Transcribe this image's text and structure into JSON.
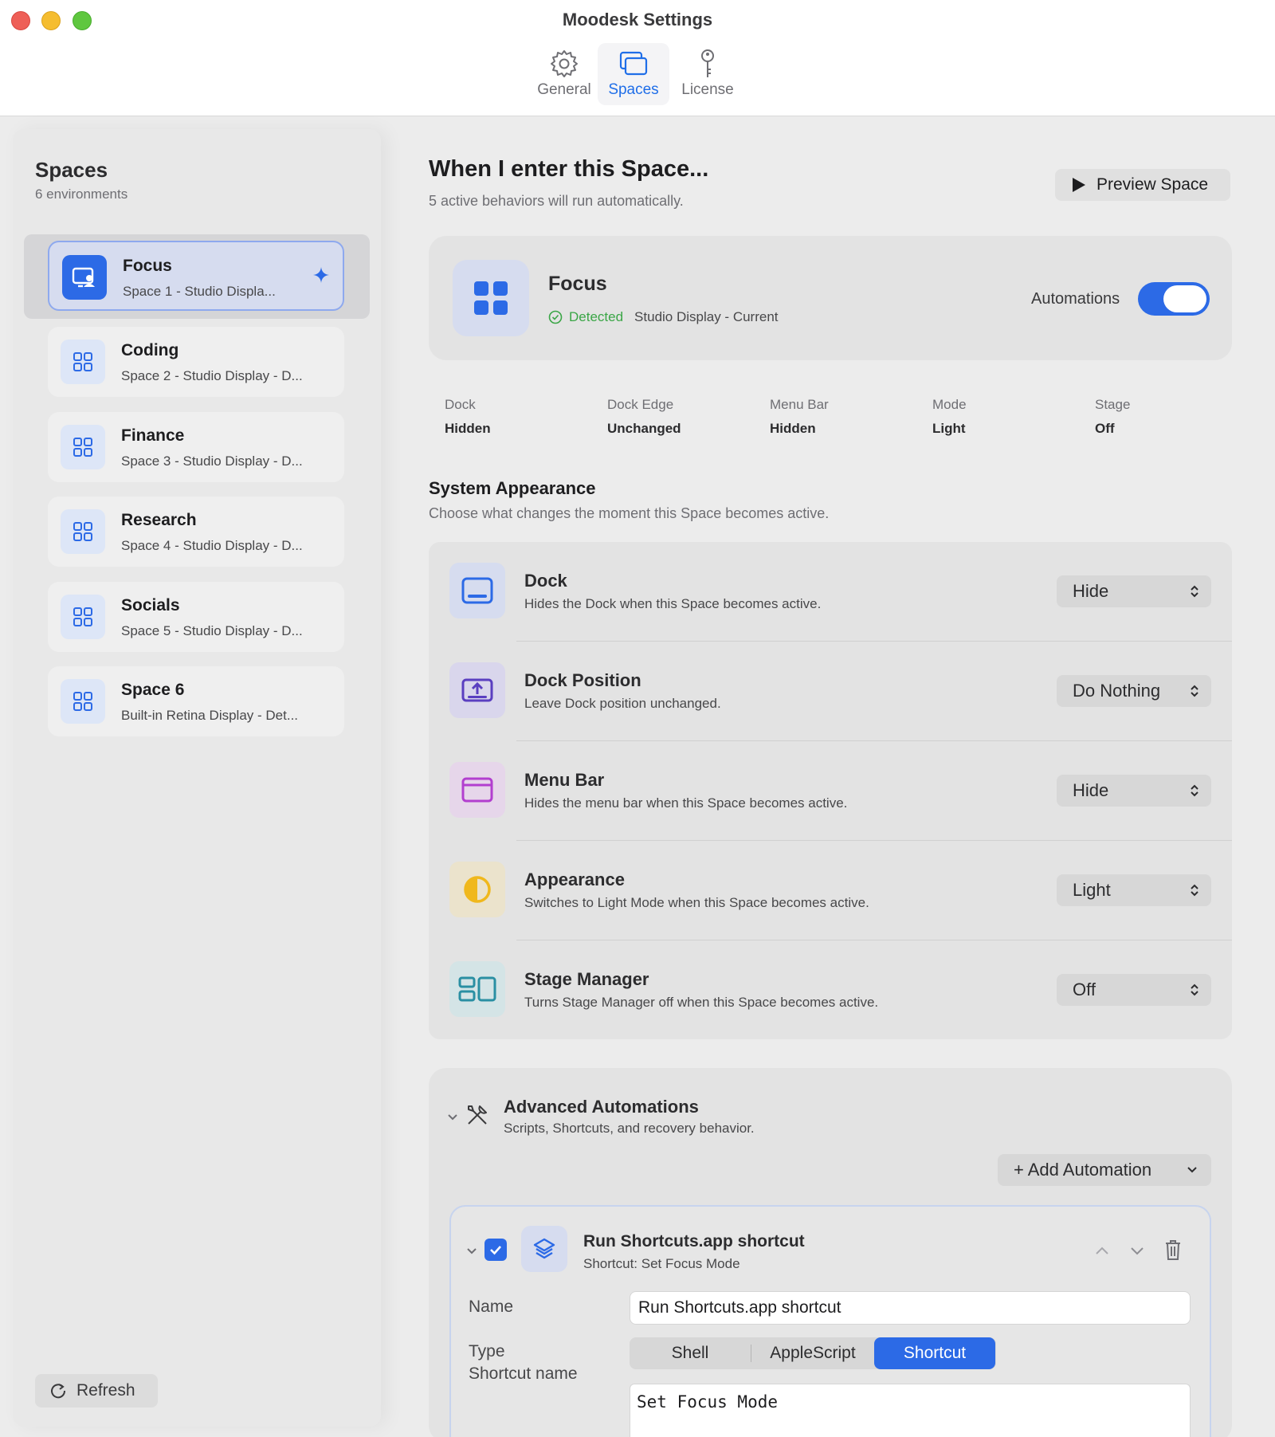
{
  "window": {
    "title": "Moodesk Settings"
  },
  "toolbar": {
    "tabs": [
      {
        "label": "General",
        "icon": "gear-icon"
      },
      {
        "label": "Spaces",
        "icon": "windows-icon"
      },
      {
        "label": "License",
        "icon": "key-icon"
      }
    ],
    "active_tab": "Spaces"
  },
  "sidebar": {
    "title": "Spaces",
    "subtitle": "6 environments",
    "items": [
      {
        "name": "Focus",
        "desc": "Space 1 - Studio Displa...",
        "icon": "focus-display-icon"
      },
      {
        "name": "Coding",
        "desc": "Space 2 - Studio Display - D...",
        "icon": "grid-icon"
      },
      {
        "name": "Finance",
        "desc": "Space 3 - Studio Display - D...",
        "icon": "grid-icon"
      },
      {
        "name": "Research",
        "desc": "Space 4 - Studio Display - D...",
        "icon": "grid-icon"
      },
      {
        "name": "Socials",
        "desc": "Space 5 - Studio Display - D...",
        "icon": "grid-icon"
      },
      {
        "name": "Space 6",
        "desc": "Built-in Retina Display - Det...",
        "icon": "grid-icon"
      }
    ],
    "selected": "Focus",
    "refresh_label": "Refresh"
  },
  "main": {
    "title": "When I enter this Space...",
    "subtitle": "5 active behaviors will run automatically.",
    "preview_label": "Preview Space",
    "focus_card": {
      "name": "Focus",
      "status": "Detected",
      "display": "Studio Display - Current",
      "automations_label": "Automations",
      "automations_on": true
    },
    "summary": [
      {
        "label": "Dock",
        "value": "Hidden"
      },
      {
        "label": "Dock Edge",
        "value": "Unchanged"
      },
      {
        "label": "Menu Bar",
        "value": "Hidden"
      },
      {
        "label": "Mode",
        "value": "Light"
      },
      {
        "label": "Stage",
        "value": "Off"
      }
    ],
    "system_appearance": {
      "title": "System Appearance",
      "subtitle": "Choose what changes the moment this Space becomes active.",
      "rows": [
        {
          "name": "Dock",
          "desc": "Hides the Dock when this Space becomes active.",
          "value": "Hide",
          "icon": "dock-icon",
          "color": "#2c6ae6"
        },
        {
          "name": "Dock Position",
          "desc": "Leave Dock position unchanged.",
          "value": "Do Nothing",
          "icon": "dock-position-icon",
          "color": "#5a3fc0"
        },
        {
          "name": "Menu Bar",
          "desc": "Hides the menu bar when this Space becomes active.",
          "value": "Hide",
          "icon": "menu-bar-icon",
          "color": "#b23fcf"
        },
        {
          "name": "Appearance",
          "desc": "Switches to Light Mode when this Space becomes active.",
          "value": "Light",
          "icon": "appearance-icon",
          "color": "#f0b81c"
        },
        {
          "name": "Stage Manager",
          "desc": "Turns Stage Manager off when this Space becomes active.",
          "value": "Off",
          "icon": "stage-manager-icon",
          "color": "#2a8fa3"
        }
      ]
    },
    "advanced": {
      "title": "Advanced Automations",
      "subtitle": "Scripts, Shortcuts, and recovery behavior.",
      "add_label": "+ Add Automation",
      "automation": {
        "title": "Run Shortcuts.app shortcut",
        "subtitle": "Shortcut: Set Focus Mode",
        "enabled": true,
        "name_label": "Name",
        "name_value": "Run Shortcuts.app shortcut",
        "type_label": "Type",
        "type_options": [
          "Shell",
          "AppleScript",
          "Shortcut"
        ],
        "type_selected": "Shortcut",
        "shortcut_label": "Shortcut name",
        "shortcut_value": "Set Focus Mode"
      }
    }
  },
  "colors": {
    "accent": "#2c6ae6",
    "success": "#3aa646"
  }
}
